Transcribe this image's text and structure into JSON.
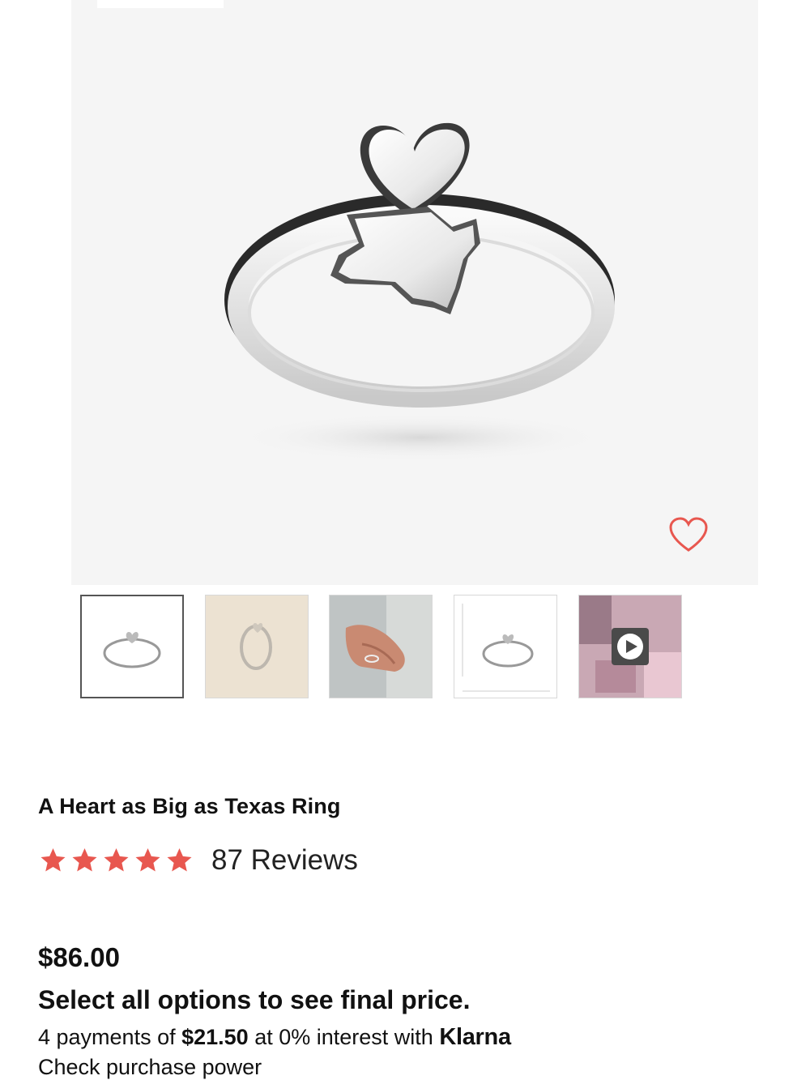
{
  "product": {
    "title": "A Heart as Big as Texas Ring",
    "rating": 5,
    "rating_max": 5,
    "reviews_label": "87 Reviews",
    "price": "$86.00",
    "select_note": "Select all options to see final price.",
    "klarna": {
      "prefix": "4 payments of ",
      "amount": "$21.50",
      "middle": " at 0% interest with ",
      "brand": "Klarna",
      "check_link": "Check purchase power"
    }
  },
  "icons": {
    "wishlist": "heart-outline-icon",
    "star": "star-icon",
    "video": "play-icon"
  },
  "colors": {
    "accent": "#e8574f",
    "hero_bg": "#f5f5f5",
    "text": "#111111"
  }
}
